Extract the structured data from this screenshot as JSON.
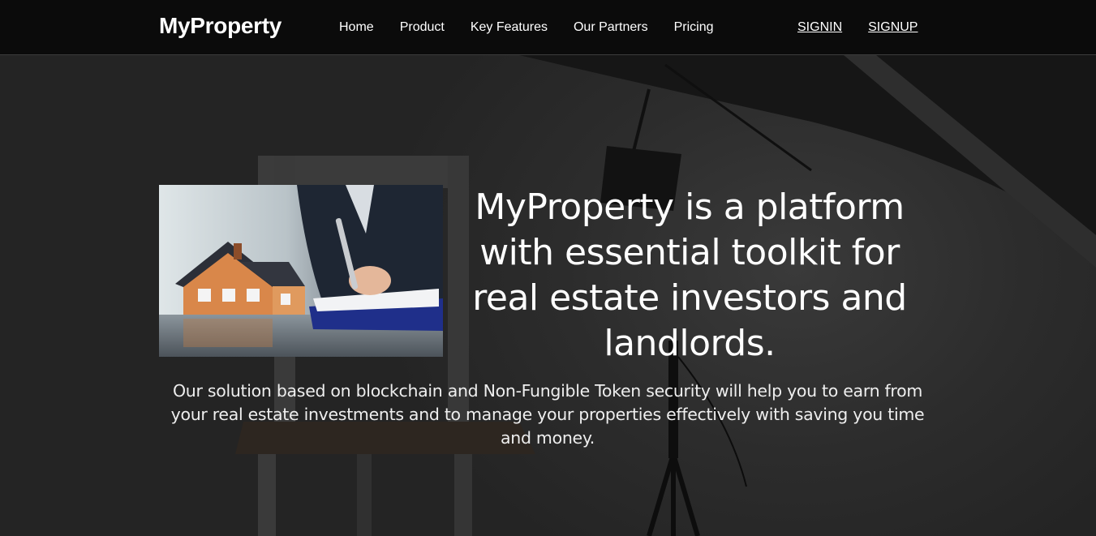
{
  "navbar": {
    "brand": "MyProperty",
    "links": [
      {
        "label": "Home"
      },
      {
        "label": "Product"
      },
      {
        "label": "Key Features"
      },
      {
        "label": "Our Partners"
      },
      {
        "label": "Pricing"
      }
    ],
    "auth": {
      "signin": "SIGNIN",
      "signup": "SIGNUP"
    }
  },
  "hero": {
    "heading": "MyProperty is a platform with essential toolkit for real estate investors and landlords.",
    "description": "Our solution based on blockchain and Non-Fungible Token security will help you to earn from your real estate investments and to manage your properties effectively with saving you time and money.",
    "image": "house-model-contract-signing-photo"
  },
  "colors": {
    "navbar_bg": "#0b0b0b",
    "hero_bg": "#262626",
    "text": "#ffffff"
  }
}
